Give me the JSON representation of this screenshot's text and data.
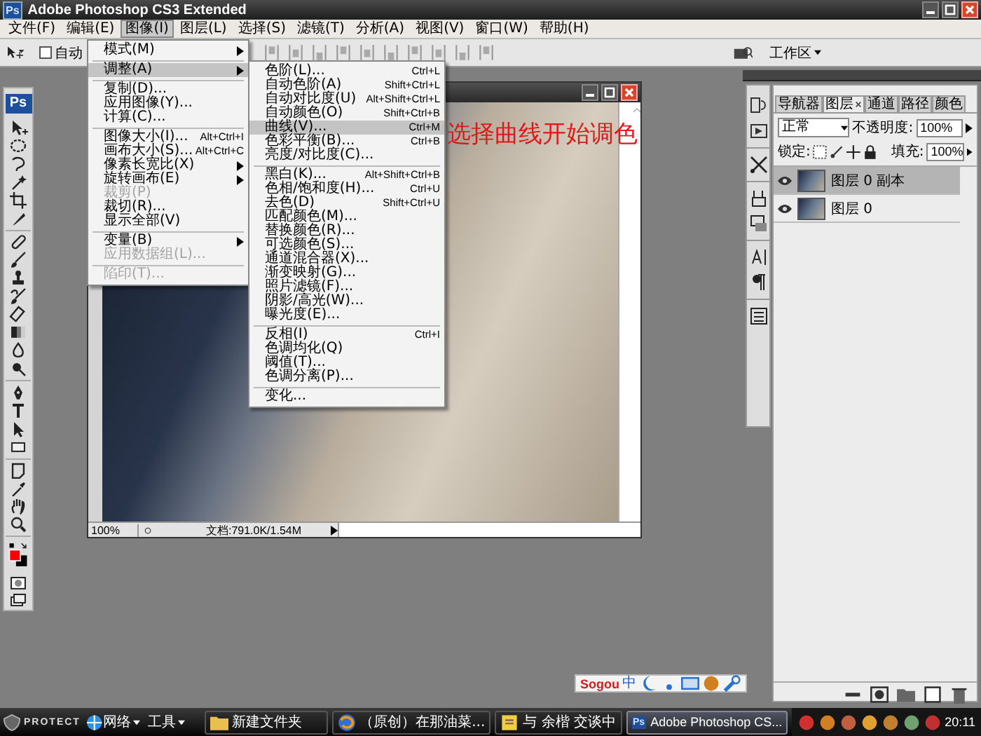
{
  "window": {
    "icon_text": "Ps",
    "title": "Adobe Photoshop CS3 Extended"
  },
  "menu_bar": [
    {
      "label": "文件(F)",
      "selected": false
    },
    {
      "label": "编辑(E)",
      "selected": false
    },
    {
      "label": "图像(I)",
      "selected": true
    },
    {
      "label": "图层(L)",
      "selected": false
    },
    {
      "label": "选择(S)",
      "selected": false
    },
    {
      "label": "滤镜(T)",
      "selected": false
    },
    {
      "label": "分析(A)",
      "selected": false
    },
    {
      "label": "视图(V)",
      "selected": false
    },
    {
      "label": "窗口(W)",
      "selected": false
    },
    {
      "label": "帮助(H)",
      "selected": false
    }
  ],
  "options_bar": {
    "auto_select": {
      "label": "自动",
      "checked": false
    },
    "workspace": "工作区"
  },
  "toolbox": {
    "logo": "Ps"
  },
  "image_menu": {
    "items": [
      {
        "kind": "item",
        "label": "模式(M)",
        "submenu": true,
        "disabled": false,
        "selected": false
      },
      {
        "kind": "separator"
      },
      {
        "kind": "item",
        "label": "调整(A)",
        "submenu": true,
        "disabled": false,
        "selected": true
      },
      {
        "kind": "separator"
      },
      {
        "kind": "item",
        "label": "复制(D)...",
        "submenu": false,
        "disabled": false,
        "selected": false
      },
      {
        "kind": "item",
        "label": "应用图像(Y)...",
        "submenu": false,
        "disabled": false,
        "selected": false
      },
      {
        "kind": "item",
        "label": "计算(C)...",
        "submenu": false,
        "disabled": false,
        "selected": false
      },
      {
        "kind": "separator"
      },
      {
        "kind": "item",
        "label": "图像大小(I)...",
        "shortcut": "Alt+Ctrl+I",
        "submenu": false,
        "disabled": false,
        "selected": false
      },
      {
        "kind": "item",
        "label": "画布大小(S)...",
        "shortcut": "Alt+Ctrl+C",
        "submenu": false,
        "disabled": false,
        "selected": false
      },
      {
        "kind": "item",
        "label": "像素长宽比(X)",
        "submenu": true,
        "disabled": false,
        "selected": false
      },
      {
        "kind": "item",
        "label": "旋转画布(E)",
        "submenu": true,
        "disabled": false,
        "selected": false
      },
      {
        "kind": "item",
        "label": "裁剪(P)",
        "submenu": false,
        "disabled": true,
        "selected": false
      },
      {
        "kind": "item",
        "label": "裁切(R)...",
        "submenu": false,
        "disabled": false,
        "selected": false
      },
      {
        "kind": "item",
        "label": "显示全部(V)",
        "submenu": false,
        "disabled": false,
        "selected": false
      },
      {
        "kind": "separator"
      },
      {
        "kind": "item",
        "label": "变量(B)",
        "submenu": true,
        "disabled": false,
        "selected": false
      },
      {
        "kind": "item",
        "label": "应用数据组(L)...",
        "submenu": false,
        "disabled": true,
        "selected": false
      },
      {
        "kind": "separator"
      },
      {
        "kind": "item",
        "label": "陷印(T)...",
        "submenu": false,
        "disabled": true,
        "selected": false
      }
    ]
  },
  "adjust_submenu": {
    "items": [
      {
        "kind": "item",
        "label": "色阶(L)...",
        "shortcut": "Ctrl+L",
        "selected": false
      },
      {
        "kind": "item",
        "label": "自动色阶(A)",
        "shortcut": "Shift+Ctrl+L",
        "selected": false
      },
      {
        "kind": "item",
        "label": "自动对比度(U)",
        "shortcut": "Alt+Shift+Ctrl+L",
        "selected": false
      },
      {
        "kind": "item",
        "label": "自动颜色(O)",
        "shortcut": "Shift+Ctrl+B",
        "selected": false
      },
      {
        "kind": "item",
        "label": "曲线(V)...",
        "shortcut": "Ctrl+M",
        "selected": true
      },
      {
        "kind": "item",
        "label": "色彩平衡(B)...",
        "shortcut": "Ctrl+B",
        "selected": false
      },
      {
        "kind": "item",
        "label": "亮度/对比度(C)...",
        "selected": false
      },
      {
        "kind": "separator"
      },
      {
        "kind": "item",
        "label": "黑白(K)...",
        "shortcut": "Alt+Shift+Ctrl+B",
        "selected": false
      },
      {
        "kind": "item",
        "label": "色相/饱和度(H)...",
        "shortcut": "Ctrl+U",
        "selected": false
      },
      {
        "kind": "item",
        "label": "去色(D)",
        "shortcut": "Shift+Ctrl+U",
        "selected": false
      },
      {
        "kind": "item",
        "label": "匹配颜色(M)...",
        "selected": false
      },
      {
        "kind": "item",
        "label": "替换颜色(R)...",
        "selected": false
      },
      {
        "kind": "item",
        "label": "可选颜色(S)...",
        "selected": false
      },
      {
        "kind": "item",
        "label": "通道混合器(X)...",
        "selected": false
      },
      {
        "kind": "item",
        "label": "渐变映射(G)...",
        "selected": false
      },
      {
        "kind": "item",
        "label": "照片滤镜(F)...",
        "selected": false
      },
      {
        "kind": "item",
        "label": "阴影/高光(W)...",
        "selected": false
      },
      {
        "kind": "item",
        "label": "曝光度(E)...",
        "selected": false
      },
      {
        "kind": "separator"
      },
      {
        "kind": "item",
        "label": "反相(I)",
        "shortcut": "Ctrl+I",
        "selected": false
      },
      {
        "kind": "item",
        "label": "色调均化(Q)",
        "selected": false
      },
      {
        "kind": "item",
        "label": "阈值(T)...",
        "selected": false
      },
      {
        "kind": "item",
        "label": "色调分离(P)...",
        "selected": false
      },
      {
        "kind": "separator"
      },
      {
        "kind": "item",
        "label": "变化...",
        "selected": false
      }
    ]
  },
  "document": {
    "annotation": "选择曲线开始调色",
    "zoom": "100%",
    "doc_info": "文档:791.0K/1.54M"
  },
  "layers_panel": {
    "tabs": [
      {
        "label": "导航器",
        "selected": false
      },
      {
        "label": "图层",
        "selected": true
      },
      {
        "label": "通道",
        "selected": false
      },
      {
        "label": "路径",
        "selected": false
      },
      {
        "label": "颜色",
        "selected": false
      }
    ],
    "blend_mode": "正常",
    "opacity_label": "不透明度:",
    "opacity": "100%",
    "lock_label": "锁定:",
    "fill_label": "填充:",
    "fill": "100%",
    "layers": [
      {
        "name": "图层 0 副本",
        "selected": true,
        "visible": true
      },
      {
        "name": "图层 0",
        "selected": false,
        "visible": true
      }
    ]
  },
  "ime_bar": {
    "logo": "Sogou",
    "mode": "中"
  },
  "taskbar": {
    "start": "PROTECT",
    "menus": [
      {
        "label": "网络"
      },
      {
        "label": "工具"
      }
    ],
    "tasks": [
      {
        "kind": "folder",
        "label": "新建文件夹",
        "selected": false
      },
      {
        "kind": "browser",
        "label": "（原创）在那油菜...",
        "selected": false
      },
      {
        "kind": "chat",
        "label": "与 余楷 交谈中",
        "selected": false
      },
      {
        "kind": "photoshop",
        "icon_text": "Ps",
        "label": "Adobe Photoshop CS...",
        "selected": true
      }
    ],
    "clock": "20:11"
  }
}
